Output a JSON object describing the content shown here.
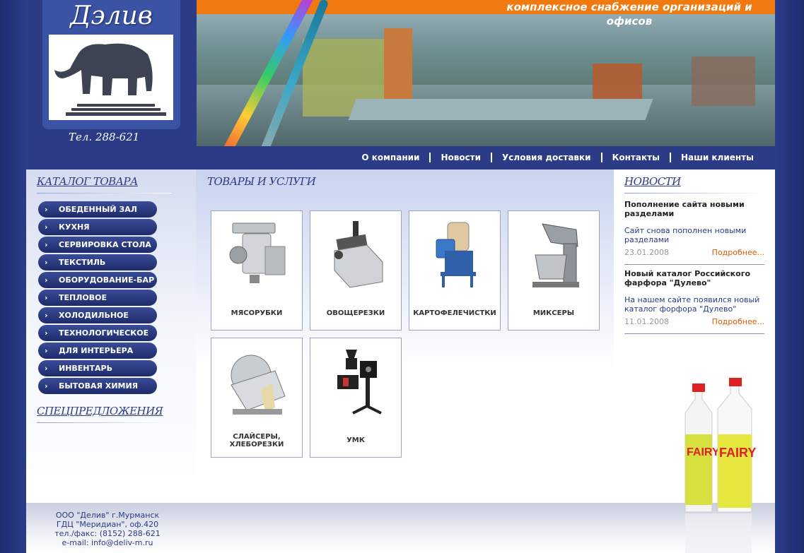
{
  "header": {
    "logo_text": "Дэлив",
    "phone": "Тел. 288-621",
    "tagline": "комплексное снабжение организаций и офисов"
  },
  "nav": {
    "items": [
      "О компании",
      "Новости",
      "Условия доставки",
      "Контакты",
      "Наши клиенты"
    ]
  },
  "sidebar": {
    "catalog_title": "КАТАЛОГ ТОВАРА",
    "items": [
      "ОБЕДЕННЫЙ ЗАЛ",
      "КУХНЯ",
      "СЕРВИРОВКА СТОЛА",
      "ТЕКСТИЛЬ",
      "ОБОРУДОВАНИЕ-БАР",
      "ТЕПЛОВОЕ",
      "ХОЛОДИЛЬНОЕ",
      "ТЕХНОЛОГИЧЕСКОЕ",
      "ДЛЯ ИНТЕРЬЕРА",
      "ИНВЕНТАРЬ",
      "БЫТОВАЯ ХИМИЯ"
    ],
    "special_title": "СПЕЦПРЕДЛОЖЕНИЯ"
  },
  "main": {
    "title": "ТОВАРЫ И УСЛУГИ",
    "products": [
      {
        "label": "МЯСОРУБКИ",
        "icon": "meat-grinder"
      },
      {
        "label": "ОВОЩЕРЕЗКИ",
        "icon": "vegetable-cutter"
      },
      {
        "label": "КАРТОФЕЛЕЧИСТКИ",
        "icon": "potato-peeler"
      },
      {
        "label": "МИКСЕРЫ",
        "icon": "mixer"
      },
      {
        "label": "СЛАЙСЕРЫ,\nХЛЕБОРЕЗКИ",
        "icon": "slicer"
      },
      {
        "label": "УМК",
        "icon": "umk"
      }
    ]
  },
  "news": {
    "title": "НОВОСТИ",
    "items": [
      {
        "head": "Пополнение сайта новыми разделами",
        "body": "Сайт снова пополнен новыми разделами",
        "date": "23.01.2008",
        "more": "Подробнее..."
      },
      {
        "head": "Новый каталог Российского фарфора \"Дулево\"",
        "body": "На нашем сайте появился новый каталог форфора \"Дулево\"",
        "date": "11.01.2008",
        "more": "Подробнее..."
      }
    ]
  },
  "footer": {
    "line1": "ООО \"Делив\" г.Мурманск",
    "line2": "ГДЦ \"Меридиан\", оф.420",
    "line3": "тел./факс: (8152) 288-621",
    "line4": "e-mail: info@deliv-m.ru"
  },
  "colors": {
    "brand_blue": "#2b3b85",
    "accent_orange": "#f07a10",
    "link_orange": "#e05a00"
  }
}
